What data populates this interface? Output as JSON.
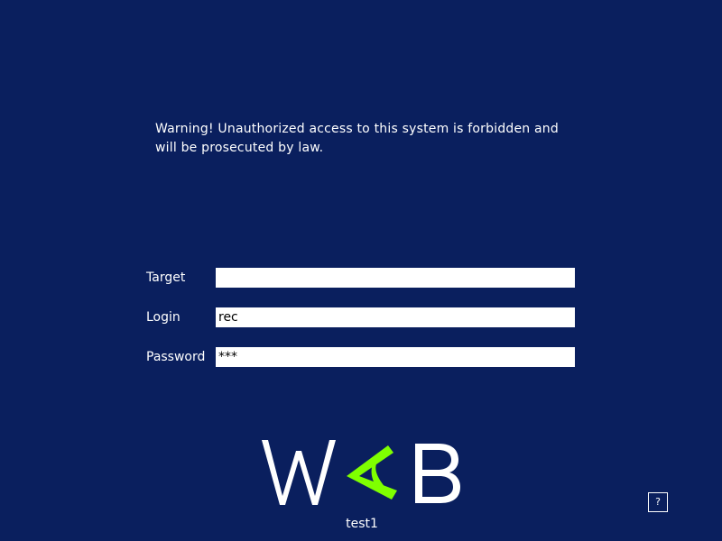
{
  "warning": {
    "text": "Warning! Unauthorized access to this system is forbidden and\nwill be prosecuted by law."
  },
  "form": {
    "target": {
      "label": "Target",
      "value": ""
    },
    "login": {
      "label": "Login",
      "value": "rec"
    },
    "password": {
      "label": "Password",
      "value": "***"
    }
  },
  "logo": {
    "text": "WAB",
    "colors": {
      "letters": "#ffffff",
      "accent": "#7fff00"
    }
  },
  "machine_name": "test1",
  "help": {
    "label": "?"
  },
  "colors": {
    "background": "#0a1f5e",
    "text": "#ffffff",
    "input_background": "#ffffff"
  }
}
